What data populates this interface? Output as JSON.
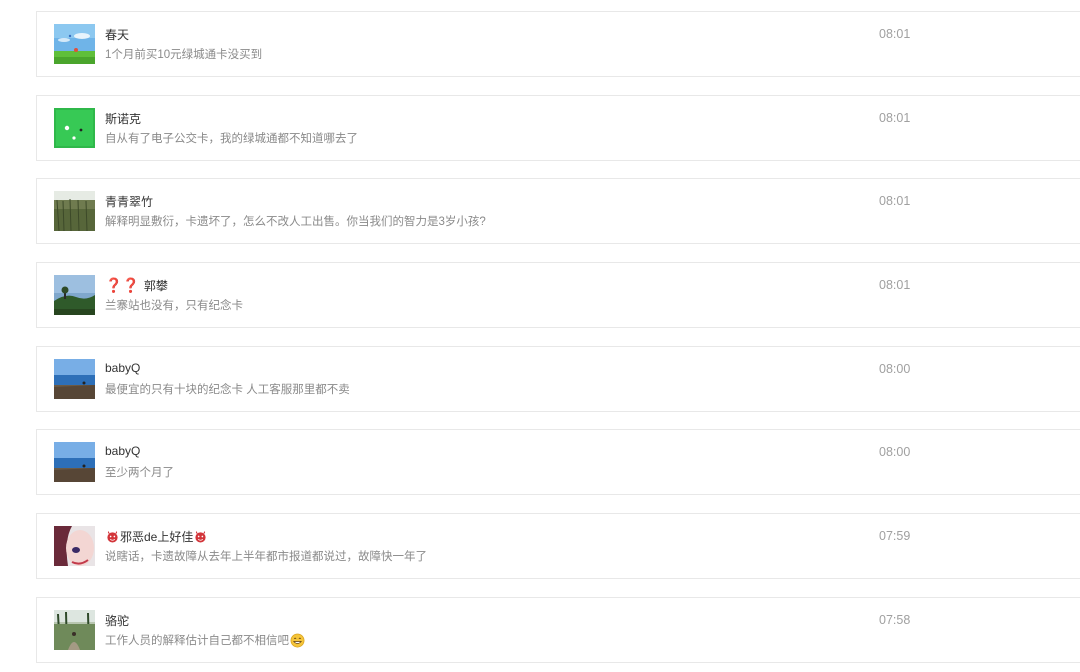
{
  "comments": [
    {
      "avatar": "avatar-sky-field",
      "name": "春天",
      "message": "1个月前买10元绿城通卡没买到",
      "time": "08:01"
    },
    {
      "avatar": "avatar-snooker-table",
      "name": "斯诺克",
      "message": "自从有了电子公交卡，我的绿城通都不知道哪去了",
      "time": "08:01"
    },
    {
      "avatar": "avatar-bamboo-landscape",
      "name": "青青翠竹",
      "message": "解释明显敷衍，卡遗坏了，怎么不改人工出售。你当我们的智力是3岁小孩?",
      "time": "08:01"
    },
    {
      "avatar": "avatar-hill-tree",
      "name_prefix": "❓❓",
      "name": "郭攀",
      "message": "兰寨站也没有，只有纪念卡",
      "time": "08:01"
    },
    {
      "avatar": "avatar-seaside",
      "name": "babyQ",
      "message": "最便宜的只有十块的纪念卡 人工客服那里都不卖",
      "time": "08:00"
    },
    {
      "avatar": "avatar-seaside",
      "name": "babyQ",
      "message": "至少两个月了",
      "time": "08:00"
    },
    {
      "avatar": "avatar-girl-portrait",
      "name": "邪恶de上好佳",
      "message": "说瞎话，卡遗故障从去年上半年都市报道都说过，故障快一年了",
      "time": "07:59"
    },
    {
      "avatar": "avatar-forest-path",
      "name": "骆驼",
      "message": "工作人员的解释估计自己都不相信吧",
      "time": "07:58"
    }
  ],
  "icons": {
    "devil": "devil-emoji-icon",
    "smile": "grin-emoji-icon",
    "question": "red-question-mark-icon"
  },
  "colors": {
    "name": "#333333",
    "message": "#8a8a8a",
    "time": "#a0a0a0",
    "question_mark": "#d2231e",
    "border": "#e8e8e8"
  }
}
